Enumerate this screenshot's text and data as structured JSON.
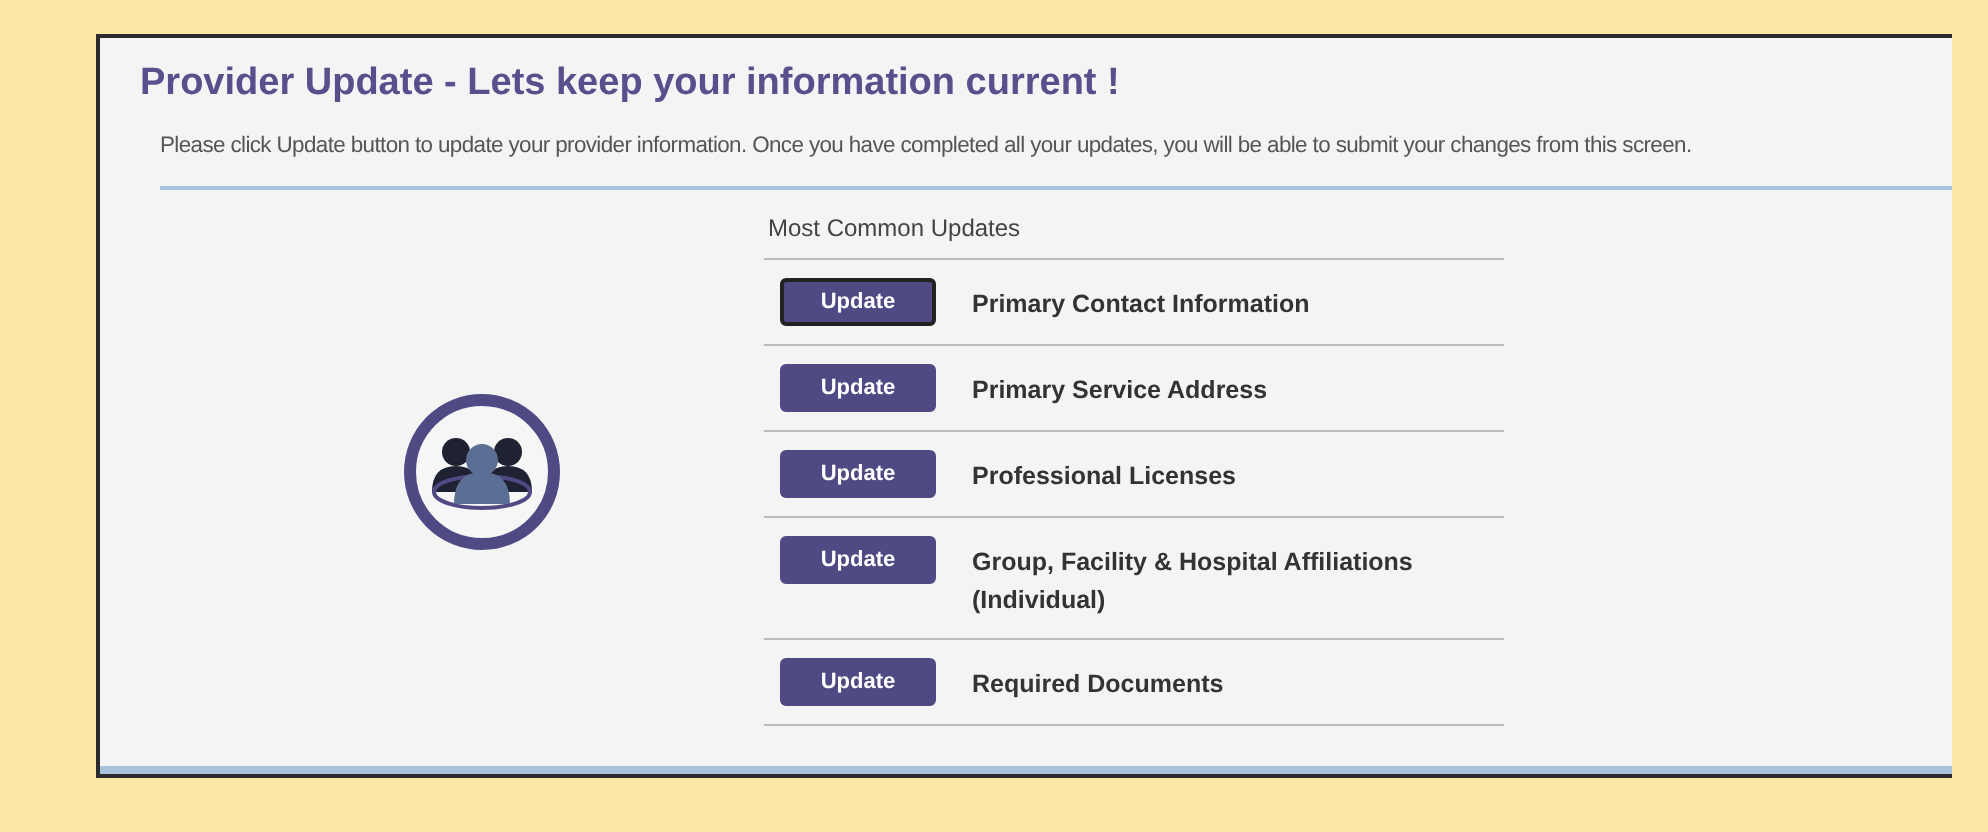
{
  "title": "Provider Update - Lets keep your information current !",
  "description": "Please click Update button to update your provider information. Once you have completed all your updates, you will be able to submit your changes from this screen.",
  "section_title": "Most Common Updates",
  "updates": [
    {
      "button": "Update",
      "label": "Primary Contact Information",
      "focused": true
    },
    {
      "button": "Update",
      "label": "Primary Service Address",
      "focused": false
    },
    {
      "button": "Update",
      "label": "Professional Licenses",
      "focused": false
    },
    {
      "button": "Update",
      "label": "Group, Facility & Hospital Affiliations (Individual)",
      "focused": false
    },
    {
      "button": "Update",
      "label": "Required Documents",
      "focused": false
    }
  ]
}
